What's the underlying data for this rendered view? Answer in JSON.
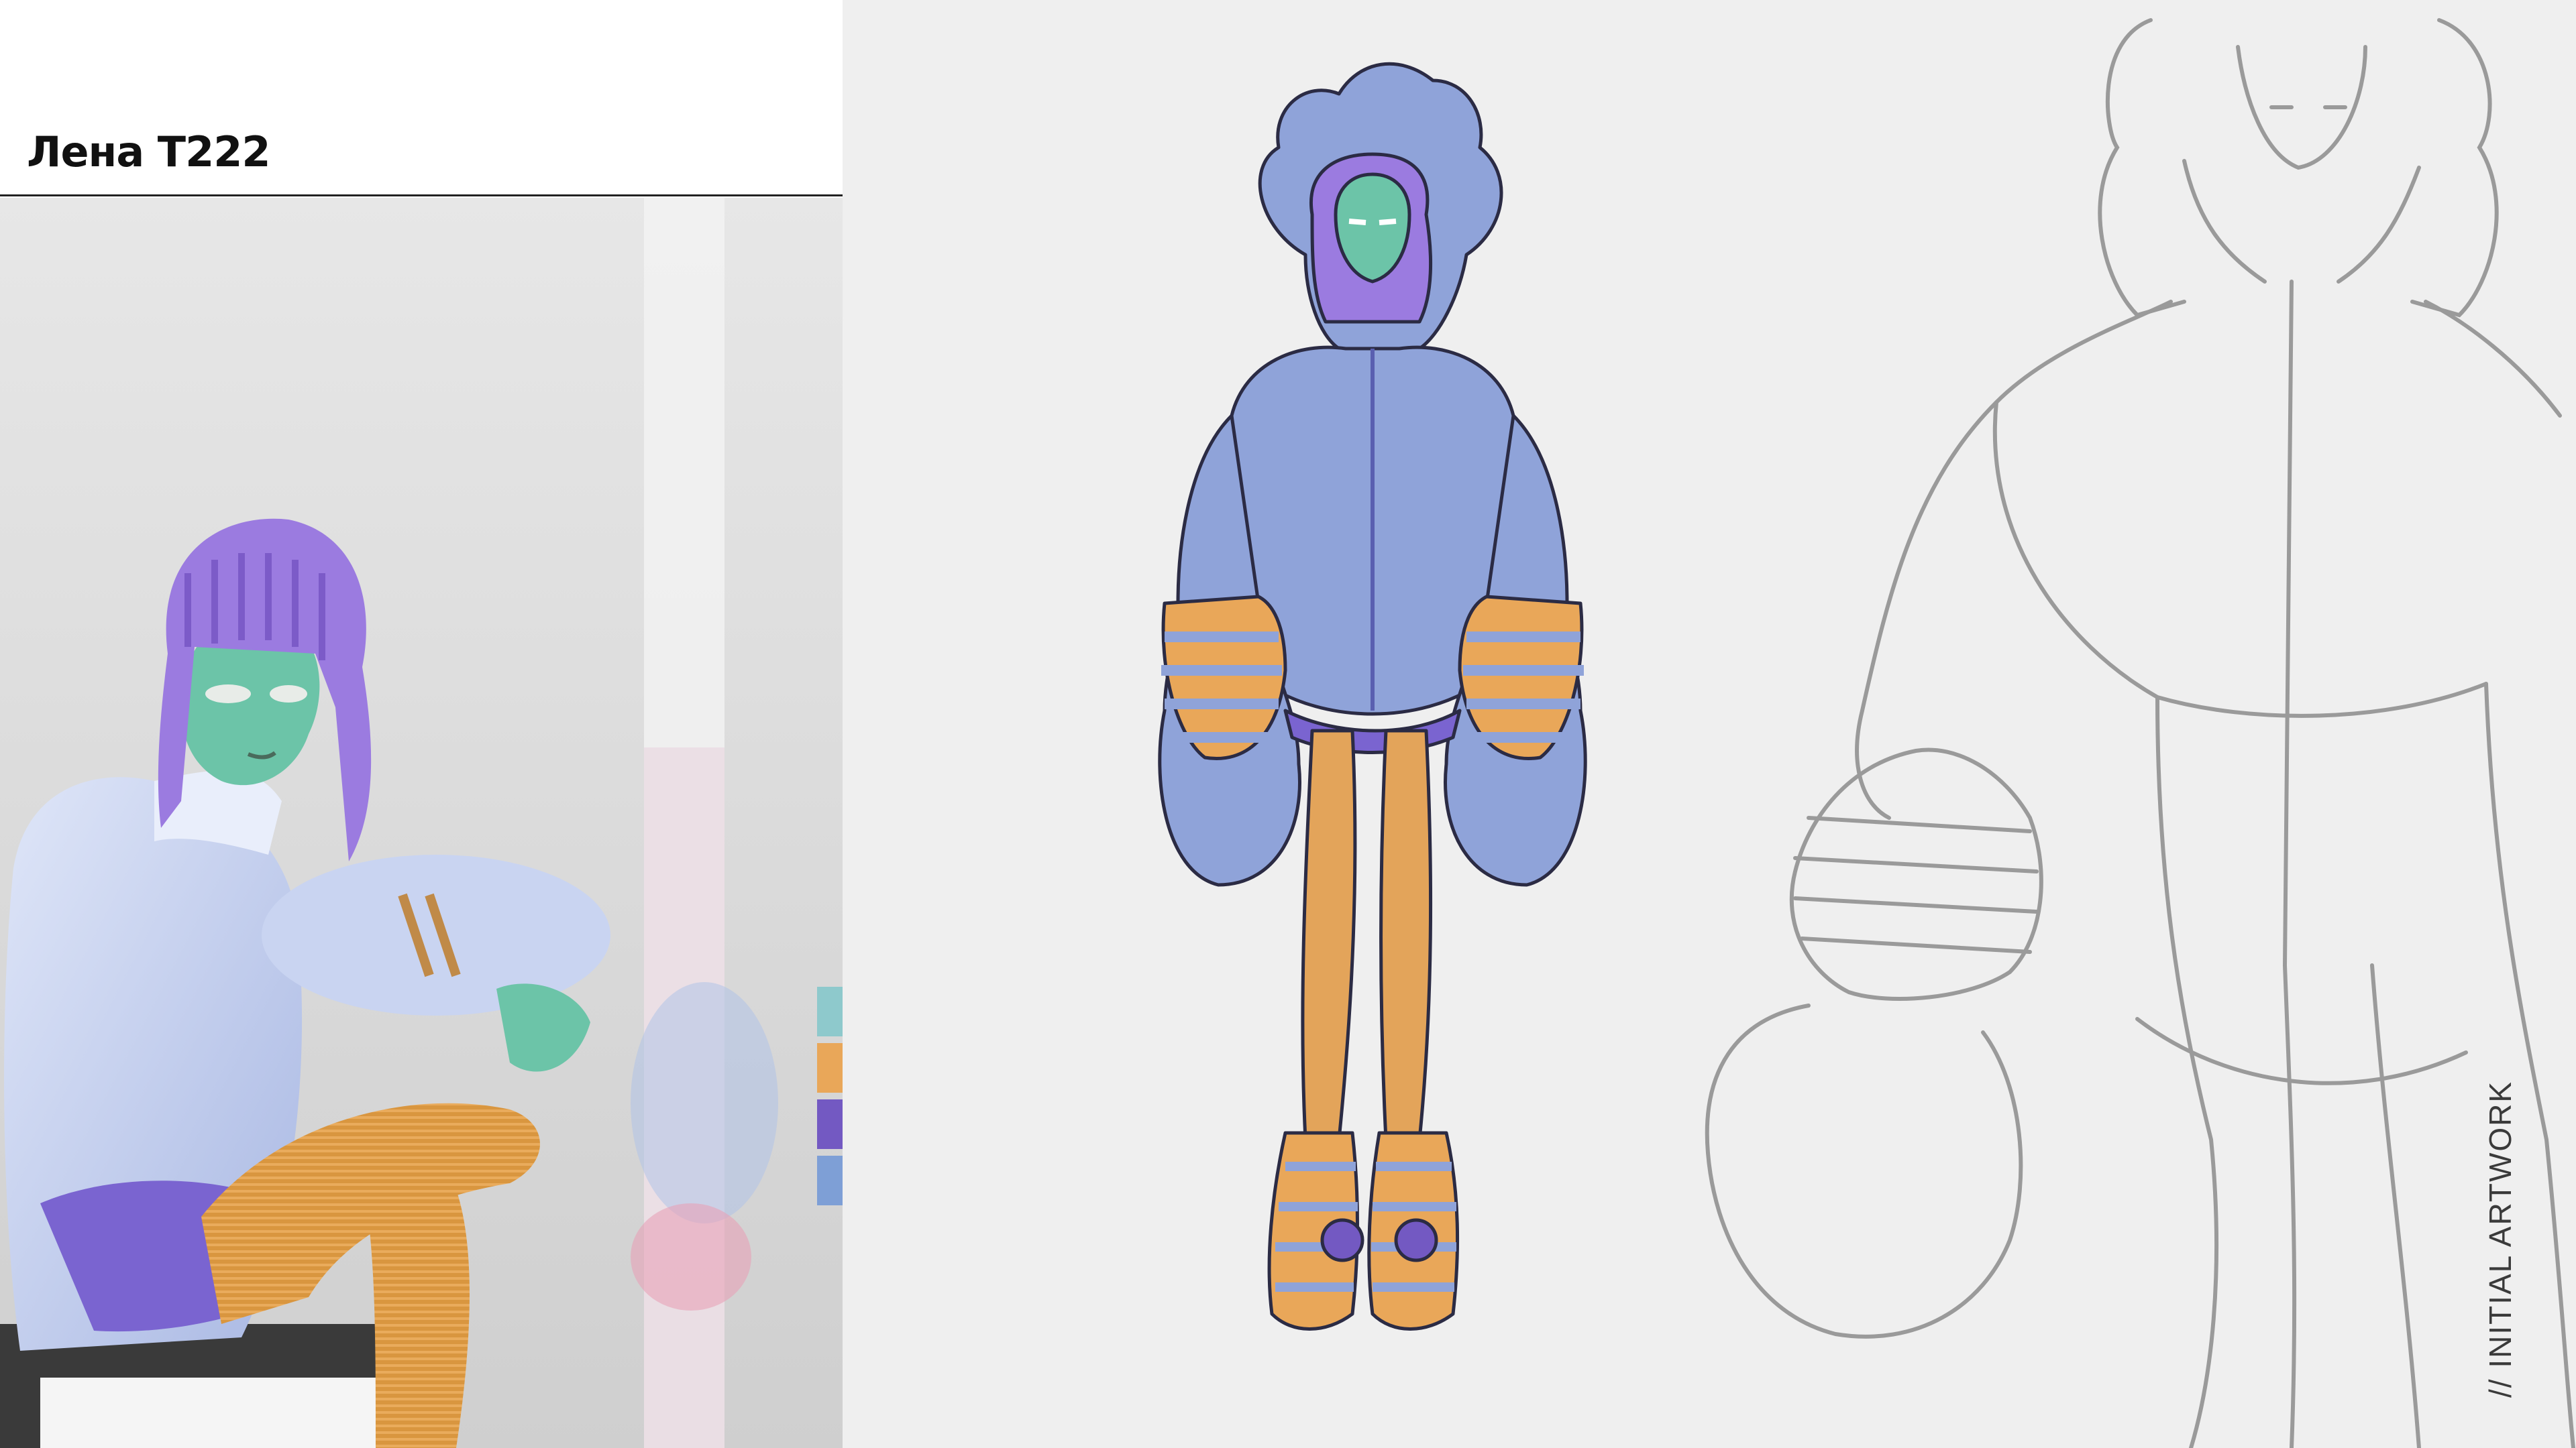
{
  "header": {
    "title": "Лена T222"
  },
  "palette": {
    "swatches": [
      {
        "color": "#8ec9cc"
      },
      {
        "color": "#e9a759"
      },
      {
        "color": "#7359c2"
      },
      {
        "color": "#7e9fd6"
      }
    ]
  },
  "caption": {
    "text": "// INITIAL ARTWORK"
  },
  "colors": {
    "jacket": "#8fa3d9",
    "jacket_shadow": "#6f83c0",
    "jacket_highlight": "#c9d6f2",
    "stripe": "#e9a759",
    "skin": "#6cc4a8",
    "hair": "#9b7be0",
    "tights": "#e3a45a",
    "render_bg": "#dcdcdc",
    "paper": "#efefef",
    "pencil": "#9a9a9a"
  },
  "icons": {
    "sticker": "flower-button-icon"
  }
}
